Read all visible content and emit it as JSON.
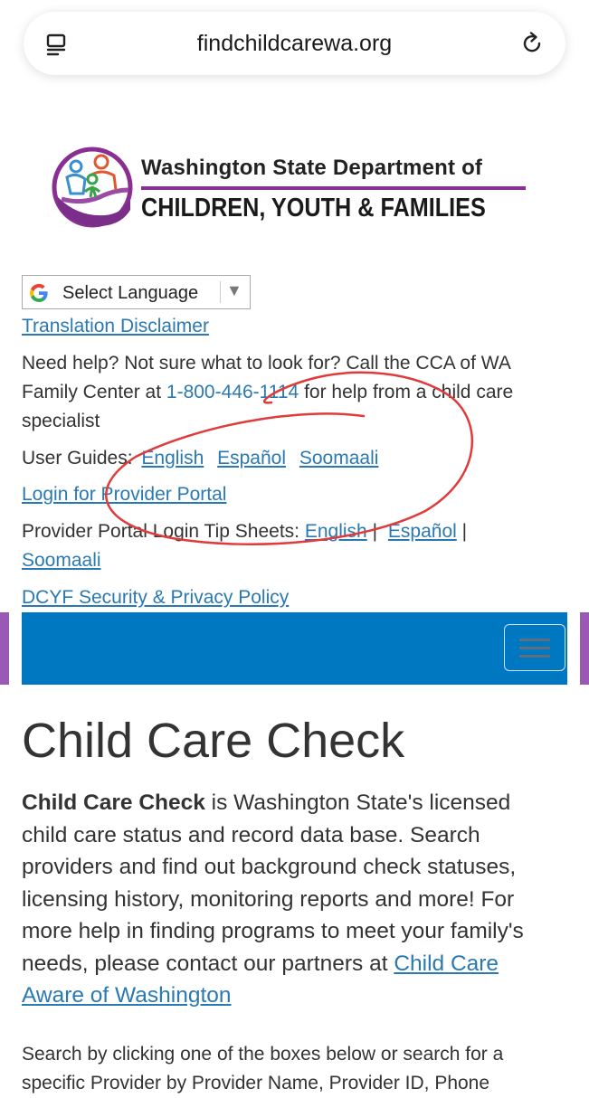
{
  "browser": {
    "url": "findchildcarewa.org"
  },
  "logo": {
    "line1": "Washington State Department of",
    "line2": "CHILDREN, YOUTH & FAMILIES"
  },
  "language": {
    "select_label": "Select Language",
    "arrow": "▼",
    "disclaimer_link": "Translation Disclaimer"
  },
  "help": {
    "line1": "Need help? Not sure what to look for? Call the CCA of WA",
    "line2_pre": "Family Center at ",
    "phone": "1-800-446-1114",
    "line2_post": " for help from a child care",
    "line3": "specialist"
  },
  "user_guides": {
    "label": "User Guides:",
    "links": [
      "English",
      "Español",
      "Soomaali"
    ]
  },
  "provider_portal": {
    "login_link": "Login for Provider Portal",
    "tips_label": "Provider Portal Login Tip Sheets:",
    "tip_links": [
      "English",
      "Español",
      "Soomaali"
    ],
    "separator": "|"
  },
  "privacy_link": "DCYF Security & Privacy Policy",
  "main": {
    "title": "Child Care Check",
    "intro_bold": "Child Care Check",
    "intro_line1": " is Washington State's licensed",
    "intro_line2": "child care status and record data base. Search",
    "intro_line3": "providers and find out background check statuses,",
    "intro_line4": "licensing history, monitoring reports and more! For",
    "intro_line5": "more help in finding programs to meet your family's",
    "intro_line6_pre": "needs, please contact our partners at ",
    "partner_link_part1": "Child Care",
    "partner_link_part2": "Aware of Washington",
    "search_line1": "Search by clicking one of the boxes below or search for a",
    "search_line2": "specific Provider by Provider Name, Provider ID, Phone"
  },
  "colors": {
    "link": "#2a79b3",
    "nav_blue": "#0078c1",
    "accent_purple": "#9b59b6",
    "annotation_red": "#e03a3a"
  },
  "icons": {
    "tabs": "tabs-icon",
    "reload": "reload-icon",
    "google": "google-g-icon",
    "menu": "hamburger-menu-icon"
  }
}
